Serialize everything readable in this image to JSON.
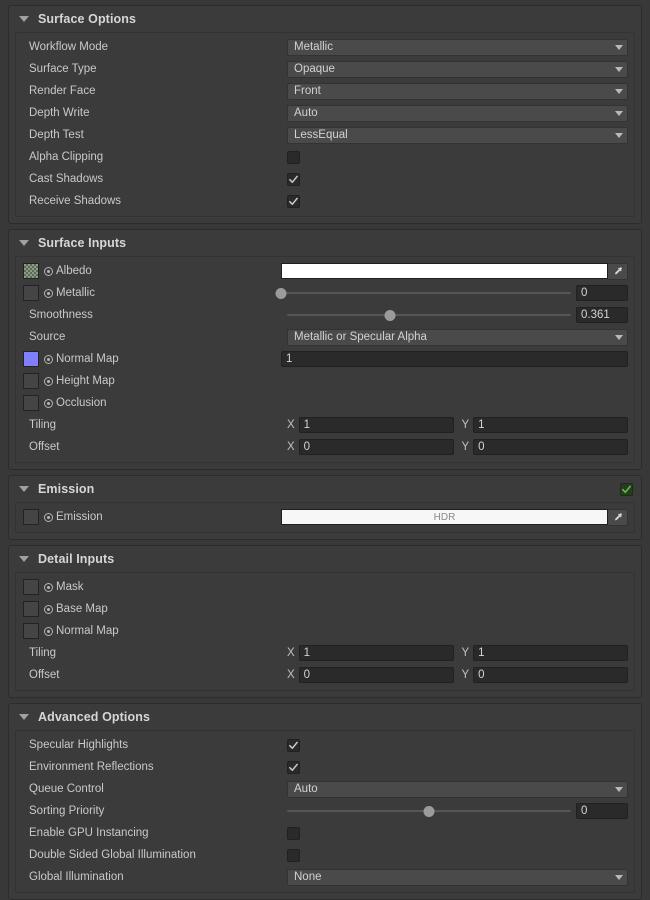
{
  "theme": {
    "bg": "#383838",
    "panel": "#3b3b3b",
    "field": "#2a2a2a",
    "dropdown": "#4a4a4a",
    "text": "#c9c9c9",
    "accent_green": "#5bbd4a",
    "normal_map_swatch": "#8080ff",
    "albedo_color": "#ffffff",
    "emission_color": "#f7f7f7"
  },
  "sections": [
    {
      "id": "surface-options",
      "title": "Surface Options",
      "foldout_icon": "chevron-down-icon",
      "expanded": true
    },
    {
      "id": "surface-inputs",
      "title": "Surface Inputs",
      "foldout_icon": "chevron-down-icon",
      "expanded": true
    },
    {
      "id": "emission",
      "title": "Emission",
      "foldout_icon": "chevron-down-icon",
      "expanded": true,
      "enabled": true
    },
    {
      "id": "detail-inputs",
      "title": "Detail Inputs",
      "foldout_icon": "chevron-down-icon",
      "expanded": true
    },
    {
      "id": "advanced-options",
      "title": "Advanced Options",
      "foldout_icon": "chevron-down-icon",
      "expanded": true
    }
  ],
  "surface_options": {
    "workflow_mode": {
      "label": "Workflow Mode",
      "value": "Metallic"
    },
    "surface_type": {
      "label": "Surface Type",
      "value": "Opaque"
    },
    "render_face": {
      "label": "Render Face",
      "value": "Front"
    },
    "depth_write": {
      "label": "Depth Write",
      "value": "Auto"
    },
    "depth_test": {
      "label": "Depth Test",
      "value": "LessEqual"
    },
    "alpha_clipping": {
      "label": "Alpha Clipping",
      "checked": false
    },
    "cast_shadows": {
      "label": "Cast Shadows",
      "checked": true
    },
    "receive_shadows": {
      "label": "Receive Shadows",
      "checked": true
    }
  },
  "surface_inputs": {
    "albedo": {
      "label": "Albedo",
      "swatch": "checker-texture",
      "color": "#ffffff",
      "eyedropper": "eyedropper-icon"
    },
    "metallic": {
      "label": "Metallic",
      "swatch": "empty-texture",
      "value": "0",
      "slider_pct": 0
    },
    "smoothness": {
      "label": "Smoothness",
      "value": "0.361",
      "slider_pct": 36.1
    },
    "source": {
      "label": "Source",
      "value": "Metallic or Specular Alpha"
    },
    "normal_map": {
      "label": "Normal Map",
      "swatch": "normal-map-texture",
      "value": "1"
    },
    "height_map": {
      "label": "Height Map",
      "swatch": "empty-texture"
    },
    "occlusion": {
      "label": "Occlusion",
      "swatch": "empty-texture"
    },
    "tiling": {
      "label": "Tiling",
      "x_label": "X",
      "x": "1",
      "y_label": "Y",
      "y": "1"
    },
    "offset": {
      "label": "Offset",
      "x_label": "X",
      "x": "0",
      "y_label": "Y",
      "y": "0"
    }
  },
  "emission": {
    "enabled": true,
    "emission": {
      "label": "Emission",
      "swatch": "empty-texture",
      "hdr_label": "HDR",
      "eyedropper": "eyedropper-icon"
    }
  },
  "detail_inputs": {
    "mask": {
      "label": "Mask",
      "swatch": "empty-texture"
    },
    "base_map": {
      "label": "Base Map",
      "swatch": "empty-texture"
    },
    "normal_map": {
      "label": "Normal Map",
      "swatch": "empty-texture"
    },
    "tiling": {
      "label": "Tiling",
      "x_label": "X",
      "x": "1",
      "y_label": "Y",
      "y": "1"
    },
    "offset": {
      "label": "Offset",
      "x_label": "X",
      "x": "0",
      "y_label": "Y",
      "y": "0"
    }
  },
  "advanced_options": {
    "specular_highlights": {
      "label": "Specular Highlights",
      "checked": true
    },
    "environment_reflections": {
      "label": "Environment Reflections",
      "checked": true
    },
    "queue_control": {
      "label": "Queue Control",
      "value": "Auto"
    },
    "sorting_priority": {
      "label": "Sorting Priority",
      "value": "0",
      "slider_pct": 50
    },
    "enable_gpu_instancing": {
      "label": "Enable GPU Instancing",
      "checked": false
    },
    "double_sided_gi": {
      "label": "Double Sided Global Illumination",
      "checked": false
    },
    "global_illumination": {
      "label": "Global Illumination",
      "value": "None"
    }
  }
}
